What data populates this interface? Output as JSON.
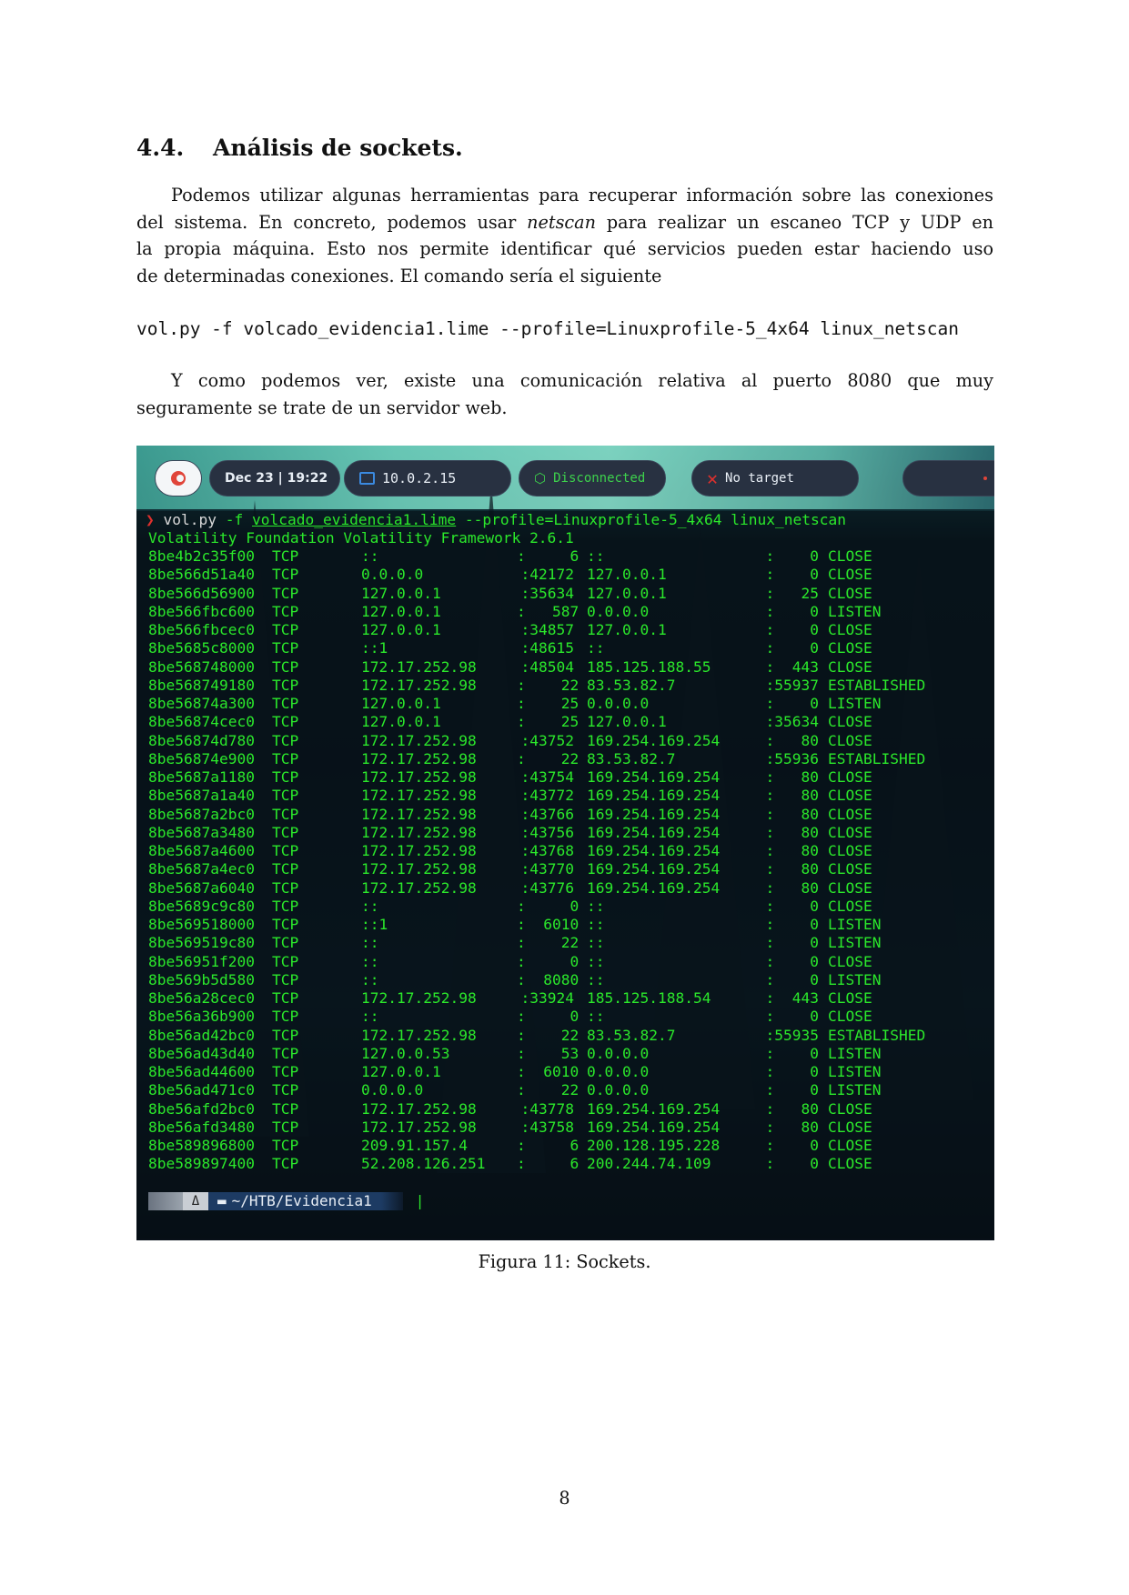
{
  "section": {
    "number": "4.4.",
    "title": "Análisis de sockets."
  },
  "para1": {
    "lines": [
      "Podemos utilizar algunas herramientas para recuperar información sobre las conexiones",
      "del sistema. En concreto, podemos usar",
      "la propia máquina. Esto nos permite identificar qué servicios pueden estar haciendo uso",
      "de determinadas conexiones. El comando sería el siguiente"
    ],
    "emph": "netscan",
    "line2_tail": "para realizar un escaneo TCP y UDP en"
  },
  "command": "vol.py -f volcado_evidencia1.lime --profile=Linuxprofile-5_4x64 linux_netscan",
  "para2": {
    "lines": [
      "Y como podemos ver, existe una comunicación relativa al puerto 8080 que muy",
      "seguramente se trate de un servidor web."
    ]
  },
  "screenshot": {
    "topbar": {
      "date": "Dec 23 | 19:22",
      "ip": "10.0.2.15",
      "vpn": "Disconnected",
      "target": "No target"
    },
    "terminal": {
      "prompt_cmd": "vol.py",
      "prompt_flag": "-f",
      "prompt_file": "volcado_evidencia1.lime",
      "prompt_rest": "--profile=Linuxprofile-5_4x64 linux_netscan",
      "banner": "Volatility Foundation Volatility Framework 2.6.1",
      "rows": [
        [
          "8be4b2c35f00",
          "TCP",
          "::",
          ":",
          "6",
          "::",
          ":",
          "0",
          "CLOSE"
        ],
        [
          "8be566d51a40",
          "TCP",
          "0.0.0.0",
          ":42172",
          "127.0.0.1",
          "",
          ":",
          "0",
          "CLOSE"
        ],
        [
          "8be566d56900",
          "TCP",
          "127.0.0.1",
          ":35634",
          "127.0.0.1",
          "",
          ":",
          "25",
          "CLOSE"
        ],
        [
          "8be566fbc600",
          "TCP",
          "127.0.0.1",
          ":",
          "587",
          "0.0.0.0",
          ":",
          "0",
          "LISTEN"
        ],
        [
          "8be566fbcec0",
          "TCP",
          "127.0.0.1",
          ":34857",
          "127.0.0.1",
          "",
          ":",
          "0",
          "CLOSE"
        ],
        [
          "8be5685c8000",
          "TCP",
          "::1",
          ":48615",
          "::",
          "",
          ":",
          "0",
          "CLOSE"
        ],
        [
          "8be568748000",
          "TCP",
          "172.17.252.98",
          ":48504",
          "185.125.188.55",
          "",
          ":",
          "443",
          "CLOSE"
        ],
        [
          "8be568749180",
          "TCP",
          "172.17.252.98",
          ":",
          "22",
          "83.53.82.7",
          ":55937",
          "",
          "ESTABLISHED"
        ],
        [
          "8be56874a300",
          "TCP",
          "127.0.0.1",
          ":",
          "25",
          "0.0.0.0",
          ":",
          "0",
          "LISTEN"
        ],
        [
          "8be56874cec0",
          "TCP",
          "127.0.0.1",
          ":",
          "25",
          "127.0.0.1",
          ":35634",
          "",
          "CLOSE"
        ],
        [
          "8be56874d780",
          "TCP",
          "172.17.252.98",
          ":43752",
          "169.254.169.254",
          "",
          ":",
          "80",
          "CLOSE"
        ],
        [
          "8be56874e900",
          "TCP",
          "172.17.252.98",
          ":",
          "22",
          "83.53.82.7",
          ":55936",
          "",
          "ESTABLISHED"
        ],
        [
          "8be5687a1180",
          "TCP",
          "172.17.252.98",
          ":43754",
          "169.254.169.254",
          "",
          ":",
          "80",
          "CLOSE"
        ],
        [
          "8be5687a1a40",
          "TCP",
          "172.17.252.98",
          ":43772",
          "169.254.169.254",
          "",
          ":",
          "80",
          "CLOSE"
        ],
        [
          "8be5687a2bc0",
          "TCP",
          "172.17.252.98",
          ":43766",
          "169.254.169.254",
          "",
          ":",
          "80",
          "CLOSE"
        ],
        [
          "8be5687a3480",
          "TCP",
          "172.17.252.98",
          ":43756",
          "169.254.169.254",
          "",
          ":",
          "80",
          "CLOSE"
        ],
        [
          "8be5687a4600",
          "TCP",
          "172.17.252.98",
          ":43768",
          "169.254.169.254",
          "",
          ":",
          "80",
          "CLOSE"
        ],
        [
          "8be5687a4ec0",
          "TCP",
          "172.17.252.98",
          ":43770",
          "169.254.169.254",
          "",
          ":",
          "80",
          "CLOSE"
        ],
        [
          "8be5687a6040",
          "TCP",
          "172.17.252.98",
          ":43776",
          "169.254.169.254",
          "",
          ":",
          "80",
          "CLOSE"
        ],
        [
          "8be5689c9c80",
          "TCP",
          "::",
          ":",
          "0",
          "::",
          ":",
          "0",
          "CLOSE"
        ],
        [
          "8be569518000",
          "TCP",
          "::1",
          ":",
          "6010",
          "::",
          ":",
          "0",
          "LISTEN"
        ],
        [
          "8be569519c80",
          "TCP",
          "::",
          ":",
          "22",
          "::",
          ":",
          "0",
          "LISTEN"
        ],
        [
          "8be56951f200",
          "TCP",
          "::",
          ":",
          "0",
          "::",
          ":",
          "0",
          "CLOSE"
        ],
        [
          "8be569b5d580",
          "TCP",
          "::",
          ":",
          "8080",
          "::",
          ":",
          "0",
          "LISTEN"
        ],
        [
          "8be56a28cec0",
          "TCP",
          "172.17.252.98",
          ":33924",
          "185.125.188.54",
          "",
          ":",
          "443",
          "CLOSE"
        ],
        [
          "8be56a36b900",
          "TCP",
          "::",
          ":",
          "0",
          "::",
          ":",
          "0",
          "CLOSE"
        ],
        [
          "8be56ad42bc0",
          "TCP",
          "172.17.252.98",
          ":",
          "22",
          "83.53.82.7",
          ":55935",
          "",
          "ESTABLISHED"
        ],
        [
          "8be56ad43d40",
          "TCP",
          "127.0.0.53",
          ":",
          "53",
          "0.0.0.0",
          ":",
          "0",
          "LISTEN"
        ],
        [
          "8be56ad44600",
          "TCP",
          "127.0.0.1",
          ":",
          "6010",
          "0.0.0.0",
          ":",
          "0",
          "LISTEN"
        ],
        [
          "8be56ad471c0",
          "TCP",
          "0.0.0.0",
          ":",
          "22",
          "0.0.0.0",
          ":",
          "0",
          "LISTEN"
        ],
        [
          "8be56afd2bc0",
          "TCP",
          "172.17.252.98",
          ":43778",
          "169.254.169.254",
          "",
          ":",
          "80",
          "CLOSE"
        ],
        [
          "8be56afd3480",
          "TCP",
          "172.17.252.98",
          ":43758",
          "169.254.169.254",
          "",
          ":",
          "80",
          "CLOSE"
        ],
        [
          "8be589896800",
          "TCP",
          "209.91.157.4",
          ":",
          "6",
          "200.128.195.228",
          ":",
          "0",
          "CLOSE"
        ],
        [
          "8be589897400",
          "TCP",
          "52.208.126.251",
          ":",
          "6",
          "200.244.74.109",
          ":",
          "0",
          "CLOSE"
        ]
      ],
      "bottom_path": "~/HTB/Evidencia1",
      "cursor": "|"
    },
    "icons": [
      "penguin-icon",
      "folder-icon",
      "monitor-icon",
      "cube-icon",
      "x-icon"
    ]
  },
  "caption": "Figura 11: Sockets.",
  "page_number": "8"
}
